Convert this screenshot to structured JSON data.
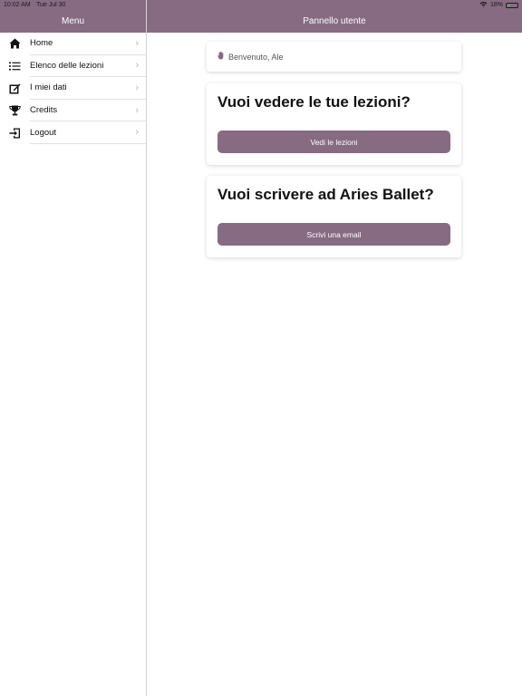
{
  "status": {
    "time": "10:02 AM",
    "date": "Tue Jul 30",
    "battery": "18%"
  },
  "nav": {
    "menu_title": "Menu",
    "main_title": "Pannello utente"
  },
  "sidebar": {
    "items": [
      {
        "label": "Home",
        "icon": "home-icon"
      },
      {
        "label": "Elenco delle lezioni",
        "icon": "list-icon"
      },
      {
        "label": "I miei dati",
        "icon": "edit-icon"
      },
      {
        "label": "Credits",
        "icon": "trophy-icon"
      },
      {
        "label": "Logout",
        "icon": "logout-icon"
      }
    ]
  },
  "welcome": {
    "text": "Benvenuto, Ale"
  },
  "cards": {
    "lessons": {
      "title": "Vuoi vedere le tue lezioni?",
      "button": "Vedi le lezioni"
    },
    "email": {
      "title": "Vuoi scrivere ad Aries Ballet?",
      "button": "Scrivi una email"
    }
  },
  "colors": {
    "accent": "#866b82"
  }
}
